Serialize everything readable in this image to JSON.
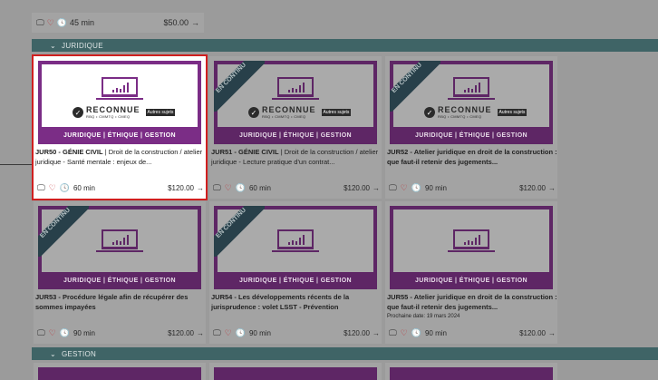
{
  "top_row": {
    "duration": "45 min",
    "price": "$50.00"
  },
  "sections": [
    {
      "label": "JURIDIQUE"
    },
    {
      "label": "GESTION"
    }
  ],
  "thumb": {
    "reconnue": "RECONNUE",
    "reconnue_sub": "RBQ • CMMTQ • CMEQ",
    "autres": "Autres sujets",
    "band": "JURIDIQUE | ÉTHIQUE | GESTION",
    "ribbon": "EN CONTINU"
  },
  "cards": [
    {
      "code": "JUR50 - GÉNIE CIVIL",
      "title": " | Droit de la construction / atelier juridique - Santé mentale : enjeux de...",
      "duration": "60 min",
      "price": "$120.00"
    },
    {
      "code": "JUR51 - GÉNIE CIVIL",
      "title": " | Droit de la construction / atelier juridique - Lecture pratique d'un contrat...",
      "duration": "60 min",
      "price": "$120.00"
    },
    {
      "code": "JUR52 - Atelier juridique en droit de la construction : que faut-il retenir des jugements...",
      "title": "",
      "duration": "90 min",
      "price": "$120.00"
    },
    {
      "code": "JUR53 - Procédure légale afin de récupérer des sommes impayées",
      "title": "",
      "duration": "90 min",
      "price": "$120.00"
    },
    {
      "code": "JUR54 - Les développements récents de la jurisprudence : volet LSST - Prévention",
      "title": "",
      "duration": "90 min",
      "price": "$120.00"
    },
    {
      "code": "JUR55 - Atelier juridique en droit de la construction : que faut-il retenir des jugements...",
      "title": "",
      "next_date": "Prochaine date: 19 mars 2024",
      "duration": "90 min",
      "price": "$120.00"
    }
  ]
}
